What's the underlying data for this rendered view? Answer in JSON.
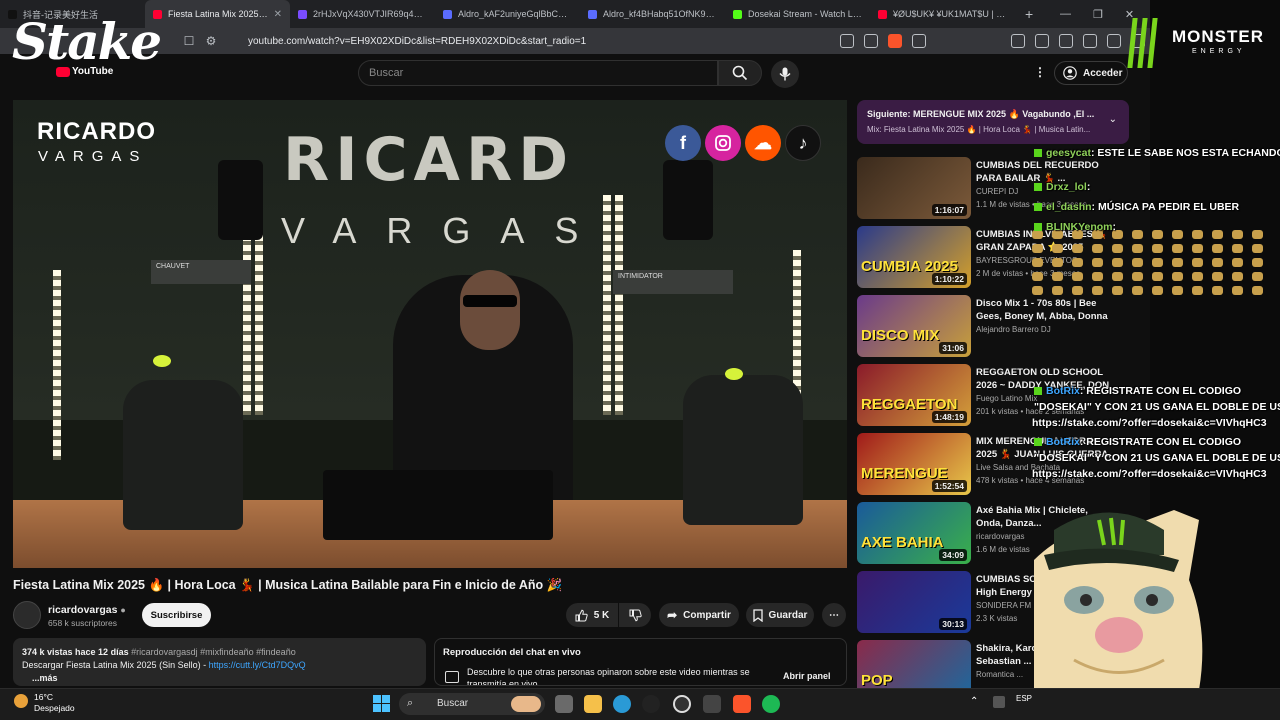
{
  "browser": {
    "tabs": [
      {
        "label": "抖音-记录美好生活",
        "color": "#111111"
      },
      {
        "label": "Fiesta Latina Mix 2025 🔥",
        "color": "#ff0033"
      },
      {
        "label": "2rHJxVqX430VTJIR69q4_rgg95",
        "color": "#7a4cff"
      },
      {
        "label": "Aldro_kAF2uniyeGqlBbChQCIll",
        "color": "#5a6cff"
      },
      {
        "label": "Aldro_kf4BHabq51OfNK987fs",
        "color": "#5a6cff"
      },
      {
        "label": "Dosekai Stream - Watch Live o",
        "color": "#53fc18"
      },
      {
        "label": "¥ØU$UK¥ ¥UK1MAT$U | Boil",
        "color": "#ff0033"
      }
    ],
    "url": "youtube.com/watch?v=EH9X02XDiDc&list=RDEH9X02XDiDc&start_radio=1"
  },
  "header": {
    "search_placeholder": "Buscar",
    "signin_label": "Acceder"
  },
  "video": {
    "brand_top": "RICARDO",
    "brand_bottom": "VARGAS",
    "wall_top": "RICARD",
    "wall_bottom": "VARGAS",
    "light_brand_1": "CHAUVET",
    "light_brand_2": "INTIMIDATOR",
    "title": "Fiesta Latina Mix 2025 🔥 | Hora Loca 💃 | Musica Latina Bailable para Fin e Inicio de Año 🎉",
    "channel": "ricardovargas",
    "subscribers": "658 k suscriptores",
    "subscribe_label": "Suscribirse",
    "likes": "5 K",
    "share_label": "Compartir",
    "save_label": "Guardar",
    "views_line": "374 k vistas  hace 12 días",
    "tags": "#ricardovargasdj #mixfindeaño #findeaño",
    "desc_line": "Descargar Fiesta Latina Mix 2025 (Sin Sello) - ",
    "desc_link": "https://cutt.ly/Ctd7DQvQ",
    "more": "...más",
    "chat_title": "Reproducción del chat en vivo",
    "chat_desc": "Descubre lo que otras personas opinaron sobre este video mientras se transmitía en vivo.",
    "chat_open": "Abrir panel"
  },
  "upnext": {
    "line1": "Siguiente: MERENGUE MIX 2025 🔥 Vagabundo ,El ...",
    "line2": "Mix: Fiesta Latina Mix 2025 🔥 | Hora Loca 💃 | Musica Latin..."
  },
  "recommendations": [
    {
      "title": "CUMBIAS DEL RECUERDO PARA BAILAR 💃 ...",
      "channel": "CUREPI DJ",
      "meta": "1.1 M de vistas • hace 3 meses",
      "duration": "1:16:07",
      "thumb_text": "",
      "c1": "#3a2a1c",
      "c2": "#7c5a3a"
    },
    {
      "title": "CUMBIAS INOLVIDABLES 💃 GRAN ZAPADA ⭐ 2025",
      "channel": "BAYRESGROUP EVENTOS",
      "meta": "2 M de vistas • hace 3 meses",
      "duration": "1:10:22",
      "thumb_text": "CUMBIA 2025",
      "c1": "#2a3a8a",
      "c2": "#d4a02a"
    },
    {
      "title": "Disco Mix 1 - 70s 80s | Bee Gees, Boney M, Abba, Donna ...",
      "channel": "Alejandro Barrero DJ",
      "meta": "",
      "duration": "31:06",
      "thumb_text": "DISCO MIX",
      "c1": "#6a3a8a",
      "c2": "#c8a03a"
    },
    {
      "title": "REGGAETON OLD SCHOOL 2026 ~ DADDY YANKEE, DON ...",
      "channel": "Fuego Latino Mix",
      "meta": "201 k vistas • hace 2 semanas",
      "duration": "1:48:19",
      "thumb_text": "REGGAETON",
      "c1": "#8a1a2a",
      "c2": "#d4a03a"
    },
    {
      "title": "MIX MERENGUE ALEGRE 2025 💃 JUAN LUIS GUERRA, EDDY...",
      "channel": "Live Salsa and Bachata",
      "meta": "478 k vistas • hace 4 semanas",
      "duration": "1:52:54",
      "thumb_text": "MERENGUE",
      "c1": "#a01a1a",
      "c2": "#e8c84a"
    },
    {
      "title": "Axé Bahia Mix | Chiclete, Onda, Danza...",
      "channel": "ricardovargas",
      "meta": "1.6 M de vistas",
      "duration": "34:09",
      "thumb_text": "AXE BAHIA",
      "c1": "#1a5a9a",
      "c2": "#3ab04a"
    },
    {
      "title": "CUMBIAS SONIDERAS 2026 High Energy ...",
      "channel": "SONIDERA FM",
      "meta": "2.3 K vistas",
      "duration": "30:13",
      "thumb_text": "",
      "c1": "#3a1a6a",
      "c2": "#1a3a9a"
    },
    {
      "title": "Shakira, Karol G, Luis Fonsi, Sebastian ...",
      "channel": "Romantica ...",
      "meta": "",
      "duration": "",
      "thumb_text": "POP",
      "c1": "#8a2a4a",
      "c2": "#1a6aa0"
    }
  ],
  "overlay": {
    "stake_logo": "Stake",
    "yt_logo": "YouTube",
    "monster": "MONSTER",
    "monster_energy": "ENERGY",
    "chat": [
      {
        "user": "geesycat",
        "msg": ": ESTE LE SABE NOS ESTA ECHANDO"
      },
      {
        "user": "Drxz_lol",
        "msg": ":"
      },
      {
        "user": "el_dashn",
        "msg": ": MÚSICA PA PEDIR EL UBER"
      },
      {
        "user": "BLINKYenom",
        "msg": ":"
      },
      {
        "user": "BotRix",
        "msg": ": REGISTRATE CON EL CODIGO"
      },
      {
        "user": "",
        "msg": "\"DOSEKAI\" Y CON 21 US GANA EL DOBLE DE US"
      },
      {
        "user": "",
        "msg": "https://stake.com/?offer=dosekai&c=VIVhqHC3"
      },
      {
        "user": "BotRix",
        "msg": ": REGISTRATE CON EL CODIGO"
      },
      {
        "user": "",
        "msg": "\"DOSEKAI\" Y CON 21 US GANA EL DOBLE DE US"
      },
      {
        "user": "",
        "msg": "https://stake.com/?offer=dosekai&c=VIVhqHC3"
      }
    ]
  },
  "taskbar": {
    "temp": "16°C",
    "weather": "Despejado",
    "search": "Buscar",
    "tray": "ESP"
  }
}
